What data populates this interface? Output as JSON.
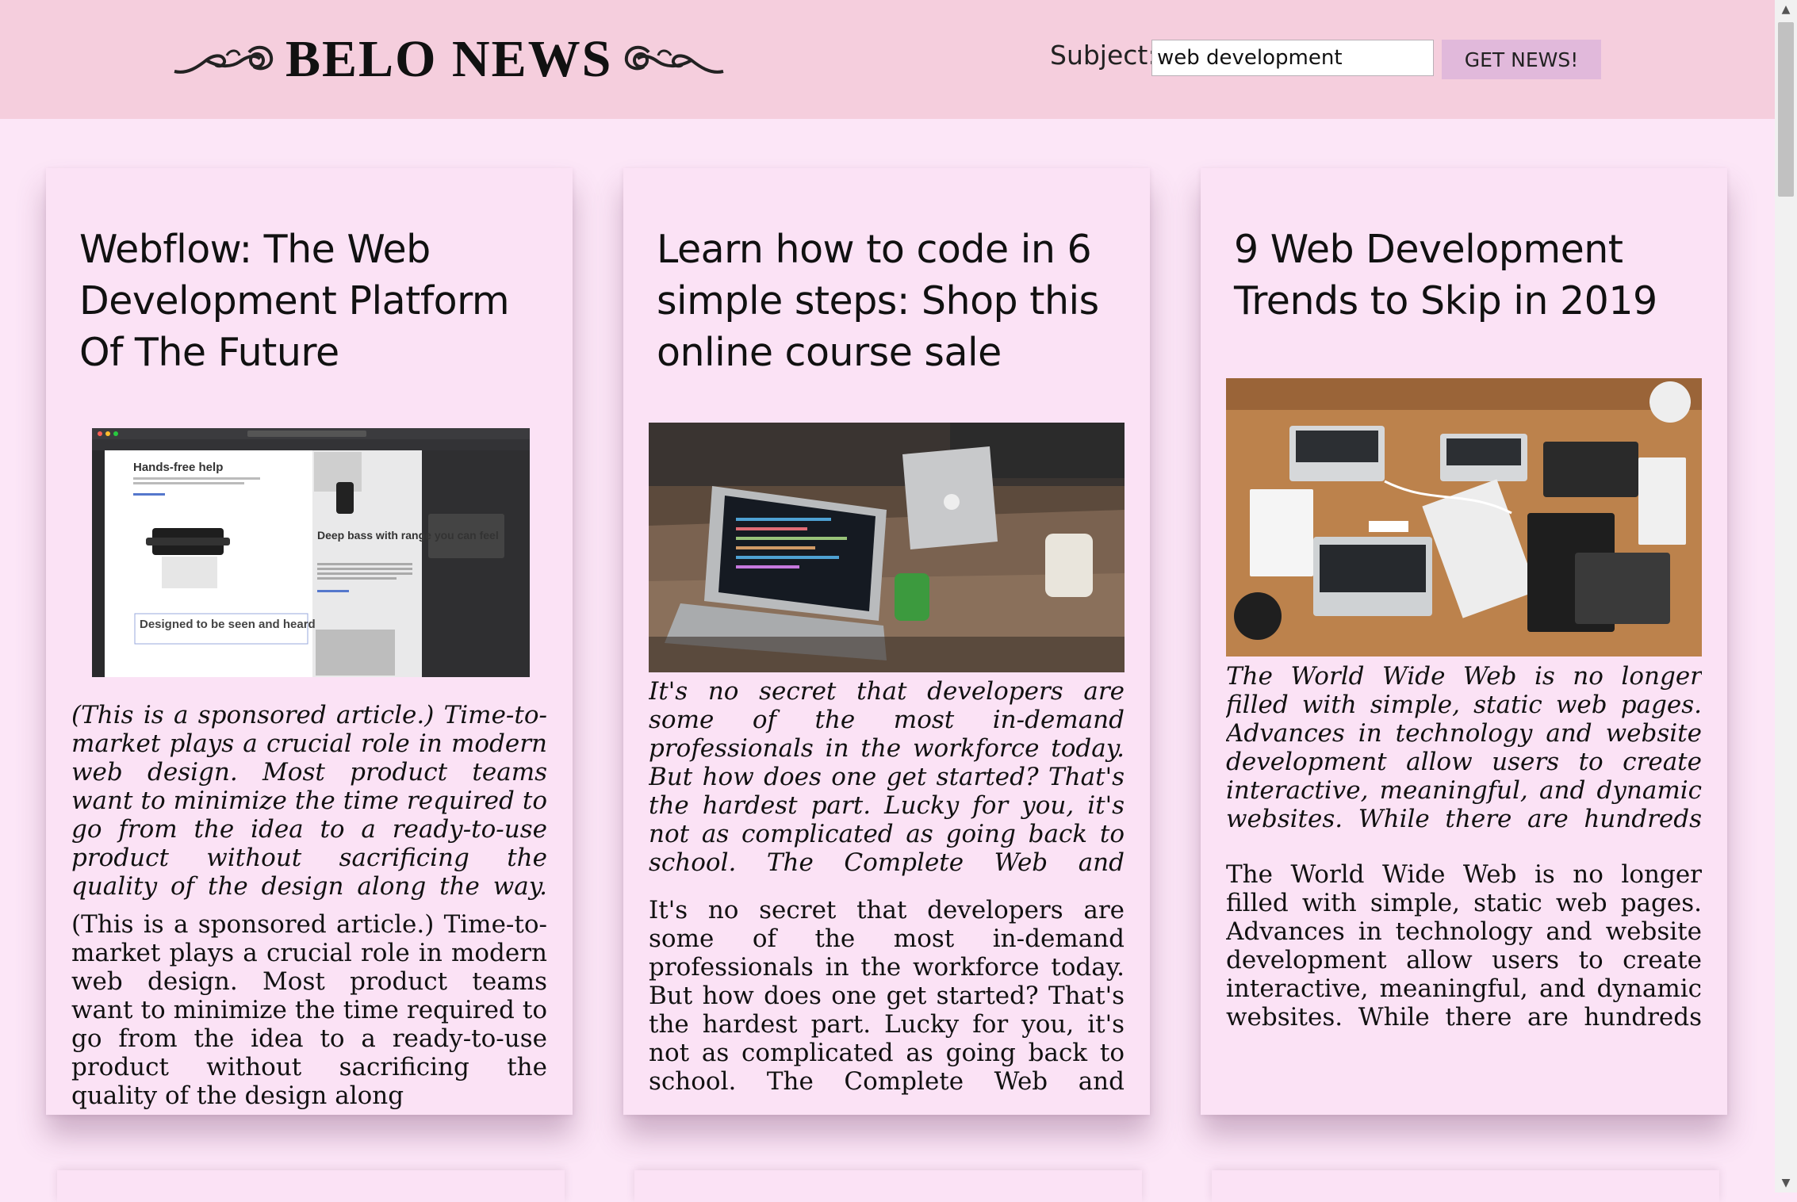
{
  "header": {
    "logo": "BELO NEWS",
    "subject_label": "Subject:",
    "subject_value": "web development",
    "button_label": "GET NEWS!"
  },
  "articles": [
    {
      "title": "Webflow: The Web Development Platform Of The Future",
      "image": {
        "label_1": "Hands-free help",
        "label_2": "Deep bass with range you can feel",
        "label_3": "Designed to be seen and heard"
      },
      "description": "(This is a sponsored article.) Time-to-market plays a crucial role in modern web design. Most product teams want to minimize the time required to go from the idea to a ready-to-use product without sacrificing the quality of the design along the way. When it c...",
      "content": "(This is a sponsored article.) Time-to-market plays a crucial role in modern web design. Most product teams want to minimize the time required to go from the idea to a ready-to-use product without sacrificing the quality of the design along"
    },
    {
      "title": "Learn how to code in 6 simple steps: Shop this online course sale",
      "description": "It's no secret that developers are some of the most in-demand professionals in the workforce today. But how does one get started? That's the hardest part. Lucky for you, it's not as complicated as going back to school. The Complete Web and Mobile Developer Bu...",
      "content": "It's no secret that developers are some of the most in-demand professionals in the workforce today. But how does one get started? That's the hardest part. Lucky for you, it's not as complicated as going back to school.  The Complete Web and Mobile"
    },
    {
      "title": "9 Web Development Trends to Skip in 2019",
      "description": "The World Wide Web is no longer filled with simple, static web pages. Advances in technology and website development allow users to create interactive, meaningful, and dynamic websites. While there are hundreds of step-by-step references to help you creativel...",
      "content": "The World Wide Web is no longer filled with simple, static web pages. Advances in technology and website development allow users to create interactive, meaningful, and dynamic websites. While there are hundreds of step-by-step"
    }
  ]
}
